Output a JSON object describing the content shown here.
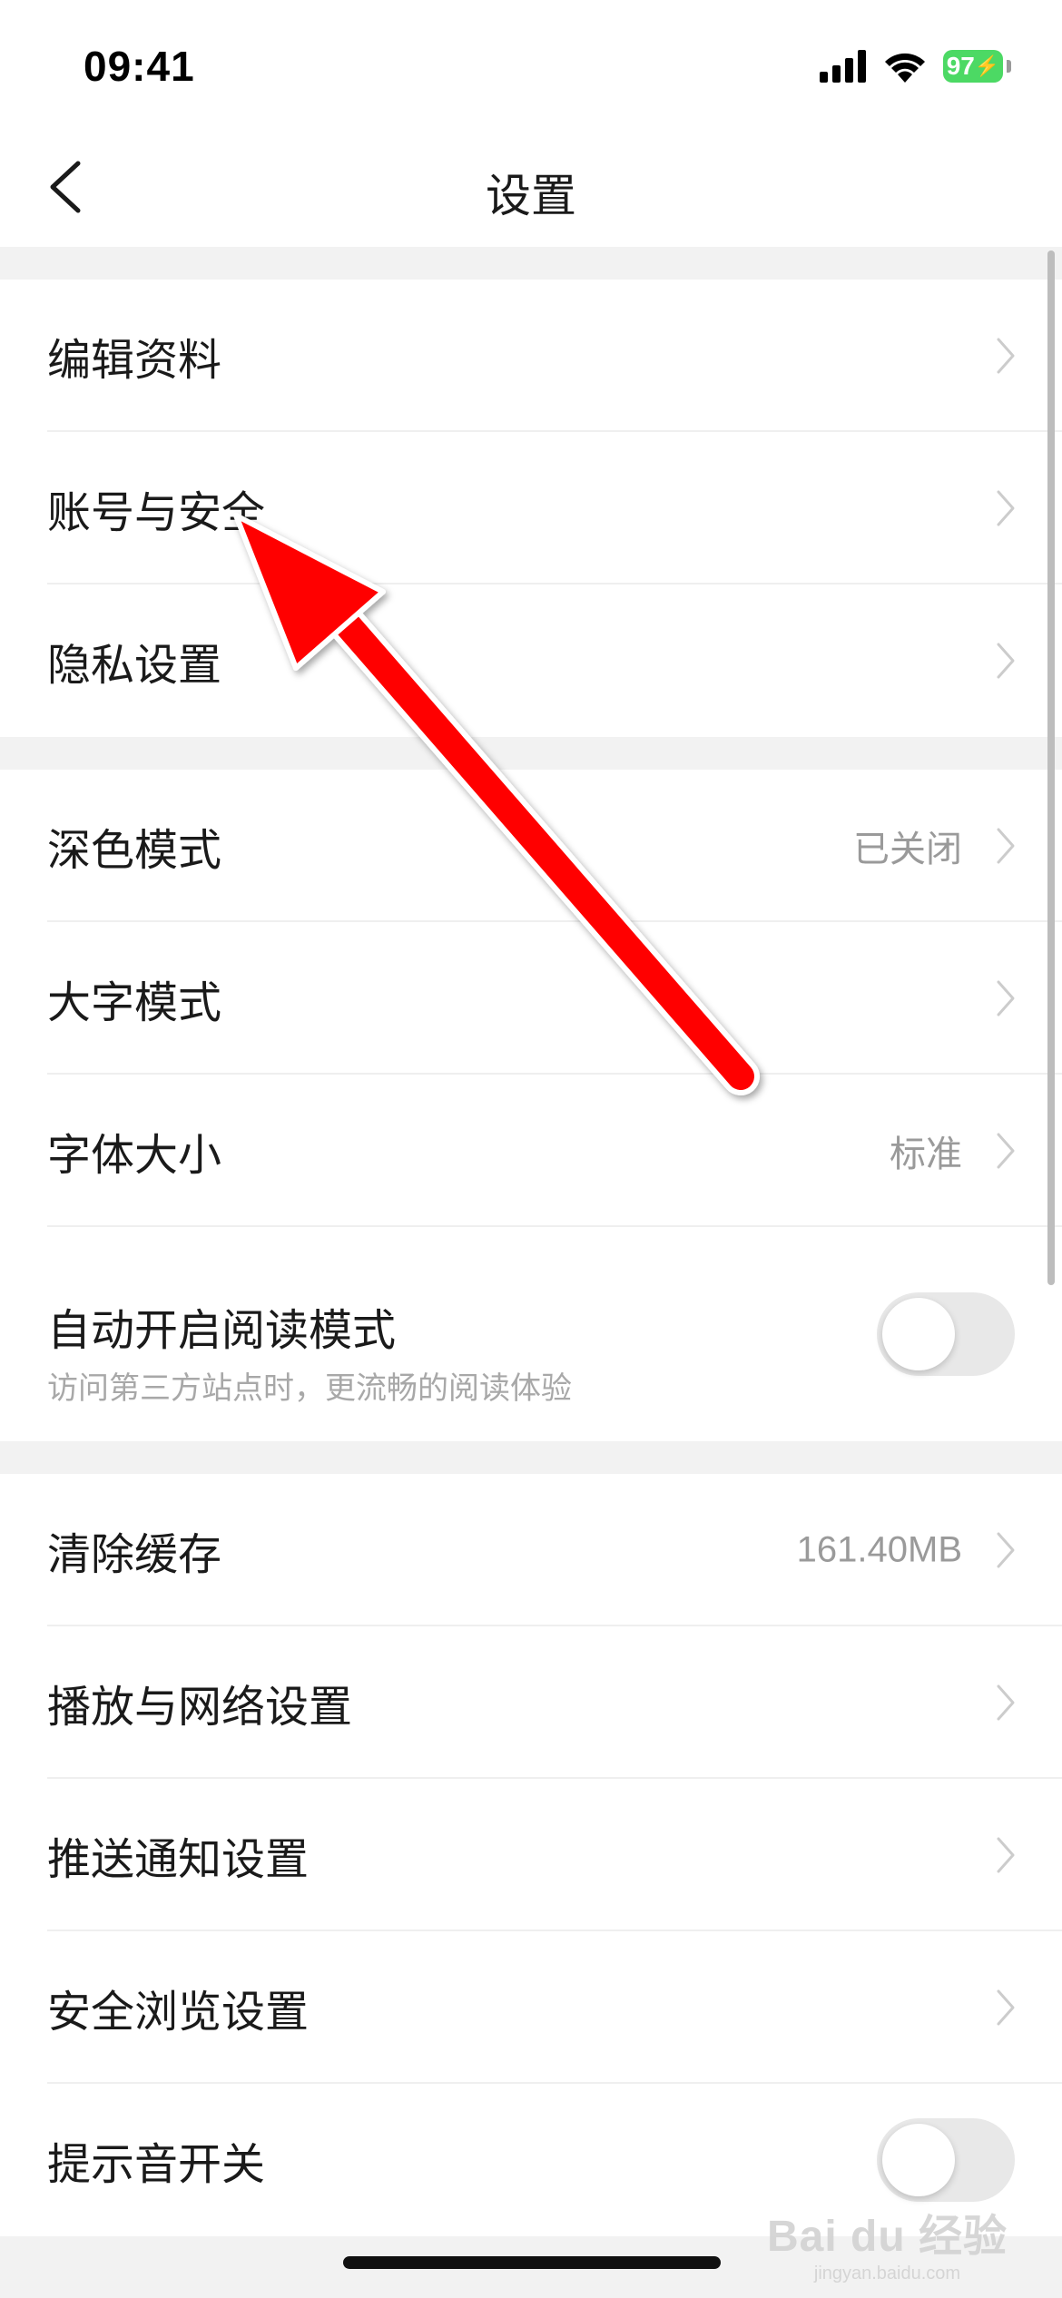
{
  "status_bar": {
    "time": "09:41",
    "battery_level": "97",
    "battery_color": "#4cd964",
    "signal_icon": "cellular-signal-icon",
    "wifi_icon": "wifi-icon"
  },
  "nav": {
    "title": "设置",
    "back_icon": "chevron-left-icon"
  },
  "groups": [
    {
      "items": [
        {
          "label": "编辑资料",
          "value": ""
        },
        {
          "label": "账号与安全",
          "value": ""
        },
        {
          "label": "隐私设置",
          "value": ""
        }
      ]
    },
    {
      "items": [
        {
          "label": "深色模式",
          "value": "已关闭"
        },
        {
          "label": "大字模式",
          "value": ""
        },
        {
          "label": "字体大小",
          "value": "标准"
        },
        {
          "label": "自动开启阅读模式",
          "sublabel": "访问第三方站点时，更流畅的阅读体验",
          "toggle": false
        }
      ]
    },
    {
      "items": [
        {
          "label": "清除缓存",
          "value": "161.40MB"
        },
        {
          "label": "播放与网络设置",
          "value": ""
        },
        {
          "label": "推送通知设置",
          "value": ""
        },
        {
          "label": "安全浏览设置",
          "value": ""
        },
        {
          "label": "提示音开关",
          "toggle": false
        }
      ]
    }
  ],
  "annotation": {
    "arrow_color": "#ff0000"
  },
  "watermark": {
    "brand": "Bai du 经验",
    "url": "jingyan.baidu.com"
  }
}
